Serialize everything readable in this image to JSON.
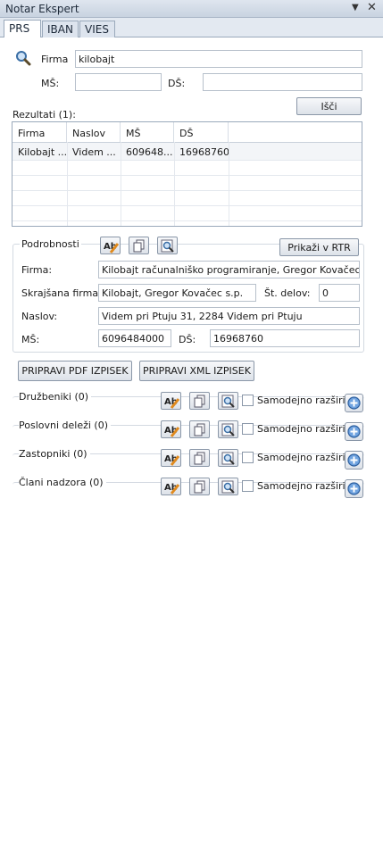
{
  "window": {
    "title": "Notar Ekspert"
  },
  "tabs": [
    {
      "label": "PRS",
      "active": true
    },
    {
      "label": "IBAN",
      "active": false
    },
    {
      "label": "VIES",
      "active": false
    }
  ],
  "search": {
    "firma_label": "Firma",
    "firma_value": "kilobajt",
    "ms_label": "MŠ:",
    "ms_value": "",
    "ds_label": "DŠ:",
    "ds_value": "",
    "search_button": "Išči"
  },
  "results": {
    "label": "Rezultati (1):",
    "columns": [
      "Firma",
      "Naslov",
      "MŠ",
      "DŠ"
    ],
    "rows": [
      [
        "Kilobajt ...",
        "Videm ...",
        "609648...",
        "16968760"
      ]
    ]
  },
  "details": {
    "group_label": "Podrobnosti",
    "rtr_button": "Prikaži v RTR",
    "firma_label": "Firma:",
    "firma_value": "Kilobajt računalniško programiranje, Gregor Kovačec s.p.",
    "skrajsana_label": "Skrajšana firma:",
    "skrajsana_value": "Kilobajt, Gregor Kovačec s.p.",
    "st_delov_label": "Št. delov:",
    "st_delov_value": "0",
    "naslov_label": "Naslov:",
    "naslov_value": "Videm pri Ptuju 31, 2284 Videm pri Ptuju",
    "ms_label": "MŠ:",
    "ms_value": "6096484000",
    "ds_label": "DŠ:",
    "ds_value": "16968760"
  },
  "actions": {
    "pdf_button": "PRIPRAVI PDF IZPISEK",
    "xml_button": "PRIPRAVI XML IZPISEK"
  },
  "sections": [
    {
      "label": "Družbeniki (0)",
      "auto_label": "Samodejno razširi"
    },
    {
      "label": "Poslovni deleži (0)",
      "auto_label": "Samodejno razširi"
    },
    {
      "label": "Zastopniki (0)",
      "auto_label": "Samodejno razširi"
    },
    {
      "label": "Člani nadzora (0)",
      "auto_label": "Samodejno razširi"
    }
  ],
  "icons": {
    "window_menu": "dropdown-icon",
    "window_close": "close-icon",
    "search": "magnifier-icon",
    "edit": "text-edit-icon",
    "copy": "copy-icon",
    "browse": "find-icon",
    "expand": "plus-circle-icon"
  }
}
